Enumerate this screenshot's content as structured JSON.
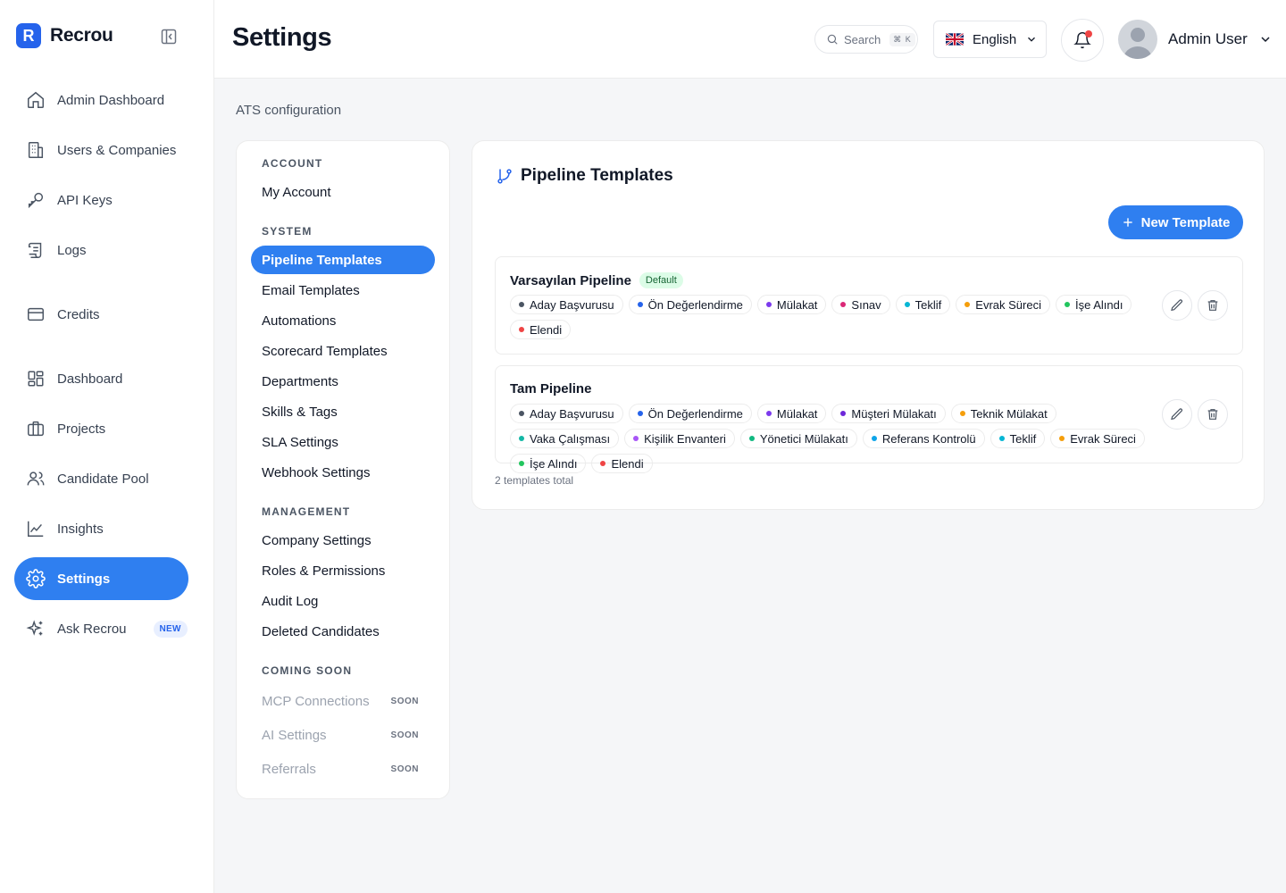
{
  "brand": {
    "name": "Recrou",
    "logo_letter": "R"
  },
  "sidebar": {
    "items": [
      {
        "label": "Admin Dashboard",
        "icon": "home-icon"
      },
      {
        "label": "Users & Companies",
        "icon": "building-icon"
      },
      {
        "label": "API Keys",
        "icon": "key-icon"
      },
      {
        "label": "Logs",
        "icon": "scroll-icon"
      },
      {
        "label": "Credits",
        "icon": "credit-card-icon"
      },
      {
        "label": "Dashboard",
        "icon": "grid-icon"
      },
      {
        "label": "Projects",
        "icon": "briefcase-icon"
      },
      {
        "label": "Candidate Pool",
        "icon": "users-icon"
      },
      {
        "label": "Insights",
        "icon": "chart-icon"
      },
      {
        "label": "Settings",
        "icon": "gear-icon",
        "active": true
      },
      {
        "label": "Ask Recrou",
        "icon": "sparkles-icon",
        "badge": "NEW"
      }
    ]
  },
  "header": {
    "title": "Settings",
    "search": {
      "label": "Search",
      "shortcut": "⌘ K"
    },
    "language": "English",
    "user_name": "Admin User"
  },
  "breadcrumb": "ATS configuration",
  "settings_menu": {
    "account_title": "ACCOUNT",
    "account_items": [
      "My Account"
    ],
    "system_title": "SYSTEM",
    "system_items": [
      "Pipeline Templates",
      "Email Templates",
      "Automations",
      "Scorecard Templates",
      "Departments",
      "Skills & Tags",
      "SLA Settings",
      "Webhook Settings"
    ],
    "management_title": "MANAGEMENT",
    "management_items": [
      "Company Settings",
      "Roles & Permissions",
      "Audit Log",
      "Deleted Candidates"
    ],
    "coming_title": "COMING SOON",
    "coming_items": [
      "MCP Connections",
      "AI Settings",
      "Referrals"
    ],
    "soon_label": "SOON"
  },
  "main": {
    "title": "Pipeline Templates",
    "new_button": "New Template",
    "templates": [
      {
        "name": "Varsayılan Pipeline",
        "badge": "Default",
        "stages": [
          {
            "label": "Aday Başvurusu",
            "color": "#4b5563"
          },
          {
            "label": "Ön Değerlendirme",
            "color": "#2563eb"
          },
          {
            "label": "Mülakat",
            "color": "#7c3aed"
          },
          {
            "label": "Sınav",
            "color": "#db2777"
          },
          {
            "label": "Teklif",
            "color": "#06b6d4"
          },
          {
            "label": "Evrak Süreci",
            "color": "#f59e0b"
          },
          {
            "label": "İşe Alındı",
            "color": "#22c55e"
          },
          {
            "label": "Elendi",
            "color": "#ef4444"
          }
        ]
      },
      {
        "name": "Tam Pipeline",
        "badge": "",
        "stages": [
          {
            "label": "Aday Başvurusu",
            "color": "#4b5563"
          },
          {
            "label": "Ön Değerlendirme",
            "color": "#2563eb"
          },
          {
            "label": "Mülakat",
            "color": "#7c3aed"
          },
          {
            "label": "Müşteri Mülakatı",
            "color": "#6d28d9"
          },
          {
            "label": "Teknik Mülakat",
            "color": "#f59e0b"
          },
          {
            "label": "Vaka Çalışması",
            "color": "#14b8a6"
          },
          {
            "label": "Kişilik Envanteri",
            "color": "#a855f7"
          },
          {
            "label": "Yönetici Mülakatı",
            "color": "#10b981"
          },
          {
            "label": "Referans Kontrolü",
            "color": "#0ea5e9"
          },
          {
            "label": "Teklif",
            "color": "#06b6d4"
          },
          {
            "label": "Evrak Süreci",
            "color": "#f59e0b"
          },
          {
            "label": "İşe Alındı",
            "color": "#22c55e"
          },
          {
            "label": "Elendi",
            "color": "#ef4444"
          }
        ]
      }
    ],
    "total_text": "2 templates total"
  },
  "colors": {
    "accent": "#2f7ff0",
    "default_badge_bg": "#dcfce7",
    "default_badge_text": "#166534"
  }
}
